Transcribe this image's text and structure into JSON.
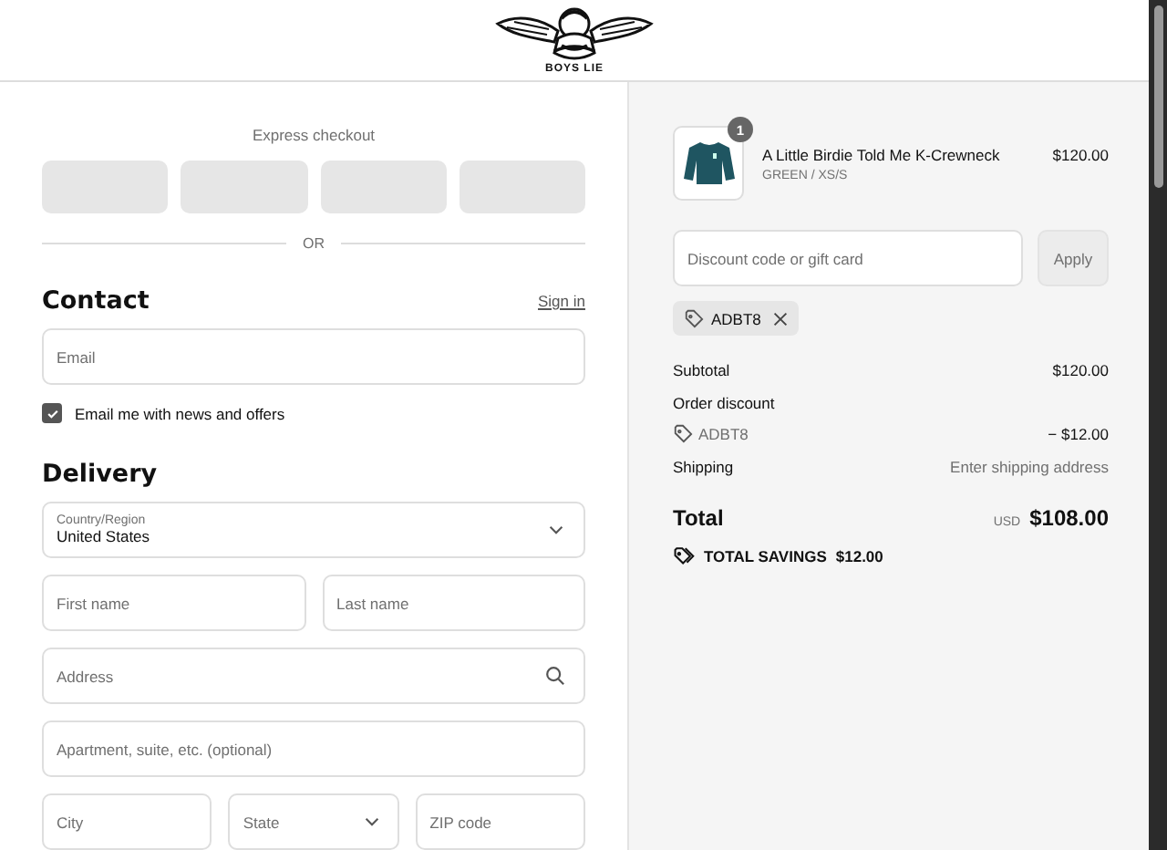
{
  "header": {
    "logo_text": "BOYS LIE"
  },
  "checkout": {
    "express_label": "Express checkout",
    "divider_label": "OR",
    "contact": {
      "heading": "Contact",
      "sign_in": "Sign in",
      "email": {
        "placeholder": "Email"
      },
      "newsletter": {
        "label": "Email me with news and offers",
        "checked": true
      }
    },
    "delivery": {
      "heading": "Delivery",
      "country": {
        "label": "Country/Region",
        "value": "United States"
      },
      "rows": [
        [
          {
            "placeholder": "First name",
            "kind": "text"
          },
          {
            "placeholder": "Last name",
            "kind": "text"
          }
        ],
        [
          {
            "placeholder": "Address",
            "kind": "search"
          }
        ],
        [
          {
            "placeholder": "Apartment, suite, etc. (optional)",
            "kind": "text"
          }
        ],
        [
          {
            "placeholder": "City",
            "kind": "text"
          },
          {
            "placeholder": "State",
            "kind": "select"
          },
          {
            "placeholder": "ZIP code",
            "kind": "text"
          }
        ]
      ]
    }
  },
  "summary": {
    "item": {
      "quantity": "1",
      "name": "A Little Birdie Told Me K-Crewneck",
      "variant": "GREEN / XS/S",
      "price": "$120.00"
    },
    "discount": {
      "placeholder": "Discount code or gift card",
      "button": "Apply"
    },
    "applied_code": "ADBT8",
    "lines": [
      {
        "kind": "plain",
        "label": "Subtotal",
        "value": "$120.00"
      },
      {
        "kind": "heading",
        "label": "Order discount"
      },
      {
        "kind": "code",
        "label": "ADBT8",
        "value": "− $12.00"
      },
      {
        "kind": "muted",
        "label": "Shipping",
        "value": "Enter shipping address"
      }
    ],
    "total": {
      "label": "Total",
      "currency": "USD",
      "value": "$108.00"
    },
    "savings": {
      "label": "TOTAL SAVINGS",
      "value": "$12.00"
    }
  }
}
